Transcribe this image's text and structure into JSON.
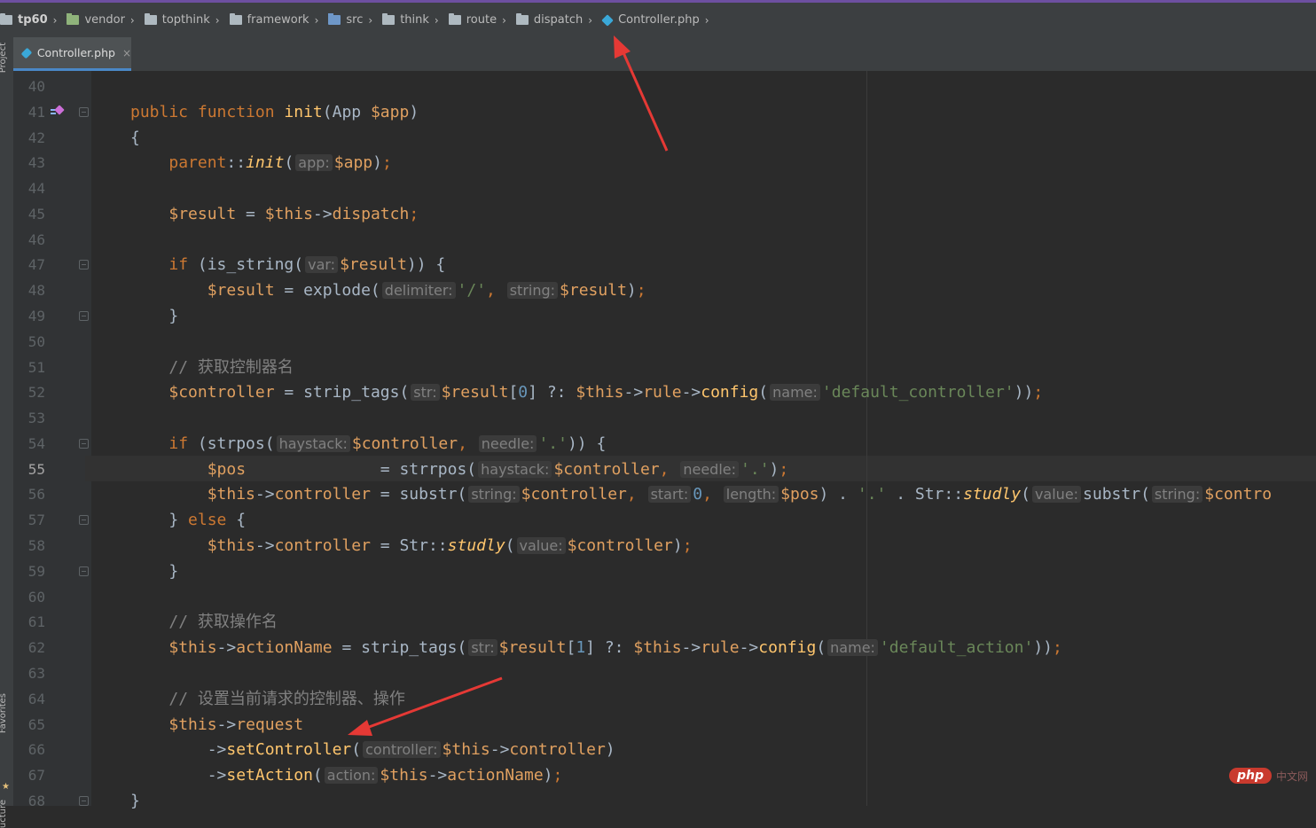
{
  "breadcrumb": [
    {
      "label": "tp60",
      "icon": "folder-icon",
      "bold": true
    },
    {
      "label": "vendor",
      "icon": "library-folder-icon"
    },
    {
      "label": "topthink",
      "icon": "folder-icon"
    },
    {
      "label": "framework",
      "icon": "folder-icon"
    },
    {
      "label": "src",
      "icon": "source-folder-icon"
    },
    {
      "label": "think",
      "icon": "folder-icon"
    },
    {
      "label": "route",
      "icon": "folder-icon"
    },
    {
      "label": "dispatch",
      "icon": "folder-icon"
    },
    {
      "label": "Controller.php",
      "icon": "php-file-icon"
    }
  ],
  "toolwindows": {
    "project": "Project",
    "favorites": "Favorites",
    "structure": "ucture"
  },
  "tab": {
    "label": "Controller.php",
    "close": "×"
  },
  "editor": {
    "current_line": "55",
    "lines": [
      {
        "n": "40",
        "tokens": []
      },
      {
        "n": "41",
        "tokens": [
          [
            "kw",
            "public "
          ],
          [
            "kw",
            "function "
          ],
          [
            "fn",
            "init"
          ],
          [
            "pl",
            "(App "
          ],
          [
            "var",
            "$app"
          ],
          [
            "pl",
            ")"
          ]
        ]
      },
      {
        "n": "42",
        "tokens": [
          [
            "pl",
            "{"
          ]
        ]
      },
      {
        "n": "43",
        "tokens": [
          [
            "pl",
            "    "
          ],
          [
            "kw",
            "parent"
          ],
          [
            "pl",
            "::"
          ],
          [
            "fn ital",
            "init"
          ],
          [
            "pl",
            "("
          ],
          [
            "hint",
            "app:"
          ],
          [
            "var",
            "$app"
          ],
          [
            "pl",
            ")"
          ],
          [
            "kw",
            ";"
          ]
        ]
      },
      {
        "n": "44",
        "tokens": []
      },
      {
        "n": "45",
        "tokens": [
          [
            "pl",
            "    "
          ],
          [
            "var",
            "$result"
          ],
          [
            "pl",
            " = "
          ],
          [
            "var",
            "$this"
          ],
          [
            "pl",
            "->"
          ],
          [
            "var",
            "dispatch"
          ],
          [
            "kw",
            ";"
          ]
        ]
      },
      {
        "n": "46",
        "tokens": []
      },
      {
        "n": "47",
        "tokens": [
          [
            "pl",
            "    "
          ],
          [
            "kw",
            "if "
          ],
          [
            "pl",
            "(is_string("
          ],
          [
            "hint",
            "var:"
          ],
          [
            "var",
            "$result"
          ],
          [
            "pl",
            ")) {"
          ]
        ]
      },
      {
        "n": "48",
        "tokens": [
          [
            "pl",
            "        "
          ],
          [
            "var",
            "$result"
          ],
          [
            "pl",
            " = explode("
          ],
          [
            "hint",
            "delimiter:"
          ],
          [
            "str",
            "'/'"
          ],
          [
            "kw",
            ", "
          ],
          [
            "hint",
            "string:"
          ],
          [
            "var",
            "$result"
          ],
          [
            "pl",
            ")"
          ],
          [
            "kw",
            ";"
          ]
        ]
      },
      {
        "n": "49",
        "tokens": [
          [
            "pl",
            "    }"
          ]
        ]
      },
      {
        "n": "50",
        "tokens": []
      },
      {
        "n": "51",
        "tokens": [
          [
            "pl",
            "    "
          ],
          [
            "com",
            "// 获取控制器名"
          ]
        ]
      },
      {
        "n": "52",
        "tokens": [
          [
            "pl",
            "    "
          ],
          [
            "var",
            "$controller"
          ],
          [
            "pl",
            " = strip_tags("
          ],
          [
            "hint",
            "str:"
          ],
          [
            "var",
            "$result"
          ],
          [
            "pl",
            "["
          ],
          [
            "num",
            "0"
          ],
          [
            "pl",
            "] ?: "
          ],
          [
            "var",
            "$this"
          ],
          [
            "pl",
            "->"
          ],
          [
            "var",
            "rule"
          ],
          [
            "pl",
            "->"
          ],
          [
            "fn",
            "config"
          ],
          [
            "pl",
            "("
          ],
          [
            "hint",
            "name:"
          ],
          [
            "str",
            "'default_controller'"
          ],
          [
            "pl",
            "))"
          ],
          [
            "kw",
            ";"
          ]
        ]
      },
      {
        "n": "53",
        "tokens": []
      },
      {
        "n": "54",
        "tokens": [
          [
            "pl",
            "    "
          ],
          [
            "kw",
            "if "
          ],
          [
            "pl",
            "(strpos("
          ],
          [
            "hint",
            "haystack:"
          ],
          [
            "var",
            "$controller"
          ],
          [
            "kw",
            ", "
          ],
          [
            "hint",
            "needle:"
          ],
          [
            "str",
            "'.'"
          ],
          [
            "pl",
            ")) {"
          ]
        ]
      },
      {
        "n": "55",
        "tokens": [
          [
            "pl",
            "        "
          ],
          [
            "var",
            "$pos"
          ],
          [
            "pl",
            "              = strrpos("
          ],
          [
            "hint",
            "haystack:"
          ],
          [
            "var",
            "$controller"
          ],
          [
            "kw",
            ", "
          ],
          [
            "hint",
            "needle:"
          ],
          [
            "str",
            "'.'"
          ],
          [
            "pl",
            ")"
          ],
          [
            "kw",
            ";"
          ]
        ]
      },
      {
        "n": "56",
        "tokens": [
          [
            "pl",
            "        "
          ],
          [
            "var",
            "$this"
          ],
          [
            "pl",
            "->"
          ],
          [
            "var",
            "controller"
          ],
          [
            "pl",
            " = substr("
          ],
          [
            "hint",
            "string:"
          ],
          [
            "var",
            "$controller"
          ],
          [
            "kw",
            ", "
          ],
          [
            "hint",
            "start:"
          ],
          [
            "num",
            "0"
          ],
          [
            "kw",
            ", "
          ],
          [
            "hint",
            "length:"
          ],
          [
            "var",
            "$pos"
          ],
          [
            "pl",
            ") . "
          ],
          [
            "str",
            "'.'"
          ],
          [
            "pl",
            " . Str::"
          ],
          [
            "fn ital",
            "studly"
          ],
          [
            "pl",
            "("
          ],
          [
            "hint",
            "value:"
          ],
          [
            "pl",
            "substr("
          ],
          [
            "hint",
            "string:"
          ],
          [
            "var",
            "$contro"
          ]
        ]
      },
      {
        "n": "57",
        "tokens": [
          [
            "pl",
            "    } "
          ],
          [
            "kw",
            "else "
          ],
          [
            "pl",
            "{"
          ]
        ]
      },
      {
        "n": "58",
        "tokens": [
          [
            "pl",
            "        "
          ],
          [
            "var",
            "$this"
          ],
          [
            "pl",
            "->"
          ],
          [
            "var",
            "controller"
          ],
          [
            "pl",
            " = Str::"
          ],
          [
            "fn ital",
            "studly"
          ],
          [
            "pl",
            "("
          ],
          [
            "hint",
            "value:"
          ],
          [
            "var",
            "$controller"
          ],
          [
            "pl",
            ")"
          ],
          [
            "kw",
            ";"
          ]
        ]
      },
      {
        "n": "59",
        "tokens": [
          [
            "pl",
            "    }"
          ]
        ]
      },
      {
        "n": "60",
        "tokens": []
      },
      {
        "n": "61",
        "tokens": [
          [
            "pl",
            "    "
          ],
          [
            "com",
            "// 获取操作名"
          ]
        ]
      },
      {
        "n": "62",
        "tokens": [
          [
            "pl",
            "    "
          ],
          [
            "var",
            "$this"
          ],
          [
            "pl",
            "->"
          ],
          [
            "var",
            "actionName"
          ],
          [
            "pl",
            " = strip_tags("
          ],
          [
            "hint",
            "str:"
          ],
          [
            "var",
            "$result"
          ],
          [
            "pl",
            "["
          ],
          [
            "num",
            "1"
          ],
          [
            "pl",
            "] ?: "
          ],
          [
            "var",
            "$this"
          ],
          [
            "pl",
            "->"
          ],
          [
            "var",
            "rule"
          ],
          [
            "pl",
            "->"
          ],
          [
            "fn",
            "config"
          ],
          [
            "pl",
            "("
          ],
          [
            "hint",
            "name:"
          ],
          [
            "str",
            "'default_action'"
          ],
          [
            "pl",
            "))"
          ],
          [
            "kw",
            ";"
          ]
        ]
      },
      {
        "n": "63",
        "tokens": []
      },
      {
        "n": "64",
        "tokens": [
          [
            "pl",
            "    "
          ],
          [
            "com",
            "// 设置当前请求的控制器、操作"
          ]
        ]
      },
      {
        "n": "65",
        "tokens": [
          [
            "pl",
            "    "
          ],
          [
            "var",
            "$this"
          ],
          [
            "pl",
            "->"
          ],
          [
            "var",
            "request"
          ]
        ]
      },
      {
        "n": "66",
        "tokens": [
          [
            "pl",
            "        ->"
          ],
          [
            "fn",
            "setController"
          ],
          [
            "pl",
            "("
          ],
          [
            "hint",
            "controller:"
          ],
          [
            "var",
            "$this"
          ],
          [
            "pl",
            "->"
          ],
          [
            "var",
            "controller"
          ],
          [
            "pl",
            ")"
          ]
        ]
      },
      {
        "n": "67",
        "tokens": [
          [
            "pl",
            "        ->"
          ],
          [
            "fn",
            "setAction"
          ],
          [
            "pl",
            "("
          ],
          [
            "hint",
            "action:"
          ],
          [
            "var",
            "$this"
          ],
          [
            "pl",
            "->"
          ],
          [
            "var",
            "actionName"
          ],
          [
            "pl",
            ")"
          ],
          [
            "kw",
            ";"
          ]
        ]
      },
      {
        "n": "68",
        "tokens": [
          [
            "pl",
            "}"
          ]
        ]
      }
    ]
  },
  "watermark": {
    "brand": "php",
    "text": "中文网"
  }
}
